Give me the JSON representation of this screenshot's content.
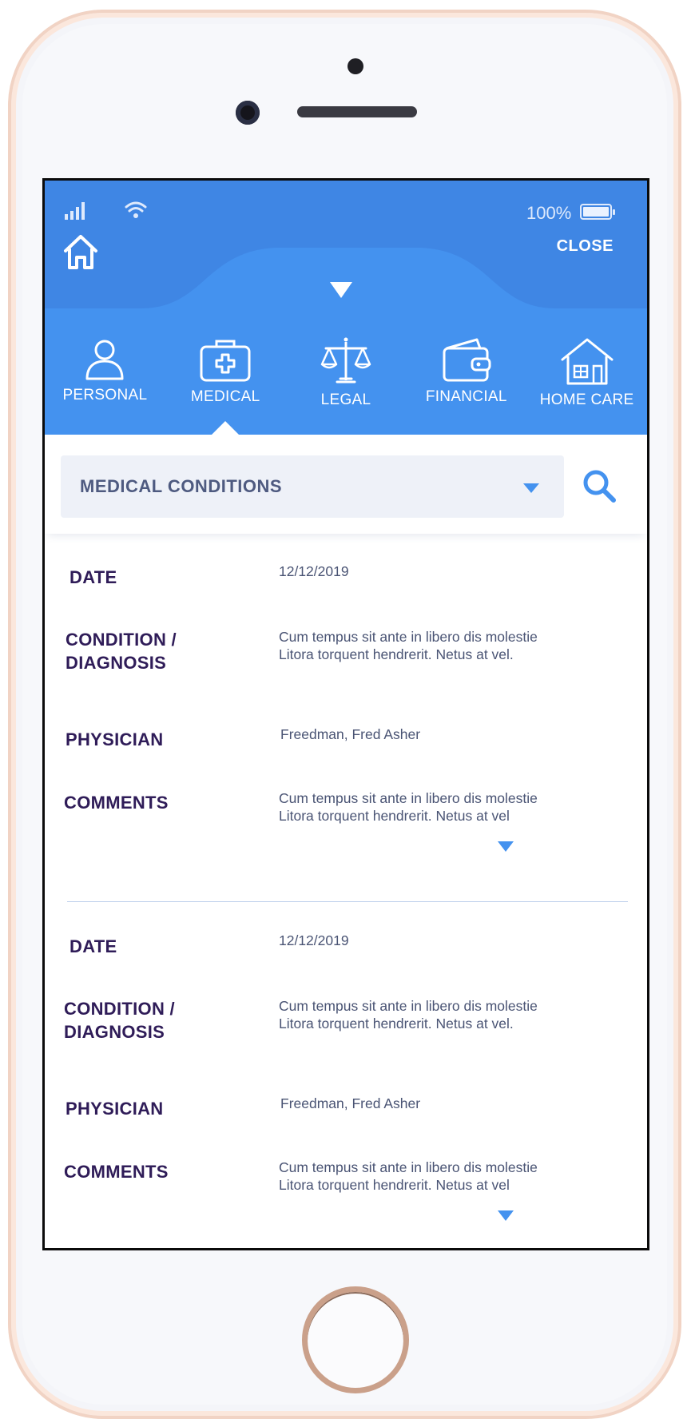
{
  "status_bar": {
    "battery_percent": "100%"
  },
  "header": {
    "close_label": "CLOSE"
  },
  "tabs": [
    {
      "label": "PERSONAL",
      "icon": "person-icon",
      "active": false
    },
    {
      "label": "MEDICAL",
      "icon": "medical-kit-icon",
      "active": true
    },
    {
      "label": "LEGAL",
      "icon": "scales-icon",
      "active": false
    },
    {
      "label": "FINANCIAL",
      "icon": "wallet-icon",
      "active": false
    },
    {
      "label": "HOME CARE",
      "icon": "house-icon",
      "active": false
    }
  ],
  "filter": {
    "selected": "MEDICAL CONDITIONS"
  },
  "records": [
    {
      "date_label": "DATE",
      "date": "12/12/2019",
      "condition_label_1": "CONDITION /",
      "condition_label_2": "DIAGNOSIS",
      "condition_line_1": "Cum tempus sit ante in libero dis molestie",
      "condition_line_2": "Litora torquent hendrerit. Netus at vel.",
      "physician_label": "PHYSICIAN",
      "physician": "Freedman, Fred Asher",
      "comments_label": "COMMENTS",
      "comments_line_1": "Cum tempus sit ante in libero dis molestie",
      "comments_line_2": "Litora torquent hendrerit. Netus at vel"
    },
    {
      "date_label": "DATE",
      "date": "12/12/2019",
      "condition_label_1": "CONDITION /",
      "condition_label_2": "DIAGNOSIS",
      "condition_line_1": "Cum tempus sit ante in libero dis molestie",
      "condition_line_2": "Litora torquent hendrerit. Netus at vel.",
      "physician_label": "PHYSICIAN",
      "physician": "Freedman, Fred Asher",
      "comments_label": "COMMENTS",
      "comments_line_1": "Cum tempus sit ante in libero dis molestie",
      "comments_line_2": "Litora torquent hendrerit. Netus at vel"
    }
  ],
  "colors": {
    "header_blue": "#4492EF",
    "label_purple": "#2F1C58",
    "value_gray": "#4A5474",
    "dropdown_bg": "#EEF1F8"
  }
}
